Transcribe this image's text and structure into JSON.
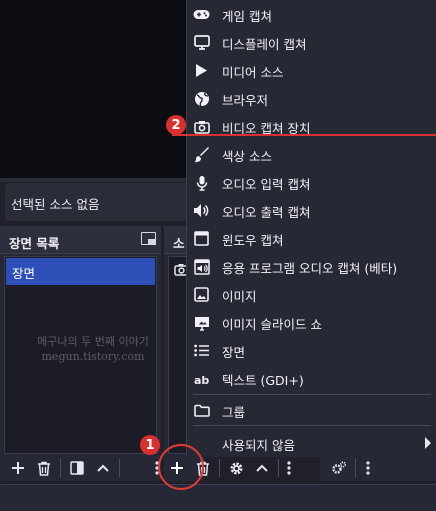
{
  "source_bar": {
    "text": "선택된 소스 없음"
  },
  "scenes": {
    "title": "장면 목록",
    "items": [
      "장면"
    ]
  },
  "sources": {
    "title": "소"
  },
  "watermark": {
    "line1": "메구나의 두 번째 이야기",
    "line2": "megun.tistory.com"
  },
  "menu": {
    "items": [
      {
        "label": "게임 캡쳐",
        "icon": "gamepad-icon"
      },
      {
        "label": "디스플레이 캡쳐",
        "icon": "monitor-icon"
      },
      {
        "label": "미디어 소스",
        "icon": "play-icon"
      },
      {
        "label": "브라우저",
        "icon": "globe-icon"
      },
      {
        "label": "비디오 캡쳐 장치",
        "icon": "camera-icon"
      },
      {
        "label": "색상 소스",
        "icon": "brush-icon"
      },
      {
        "label": "오디오 입력 캡쳐",
        "icon": "microphone-icon"
      },
      {
        "label": "오디오 출력 캡쳐",
        "icon": "speaker-icon"
      },
      {
        "label": "윈도우 캡쳐",
        "icon": "window-icon"
      },
      {
        "label": "응용 프로그램 오디오 캡쳐 (베타)",
        "icon": "app-audio-icon"
      },
      {
        "label": "이미지",
        "icon": "image-icon"
      },
      {
        "label": "이미지 슬라이드 쇼",
        "icon": "slideshow-icon"
      },
      {
        "label": "장면",
        "icon": "list-icon"
      },
      {
        "label": "텍스트 (GDI+)",
        "icon": "text-icon"
      }
    ],
    "group": {
      "label": "그룹",
      "icon": "folder-icon"
    },
    "deprecated": {
      "label": "사용되지 않음"
    }
  },
  "annotations": {
    "badge1": "1",
    "badge2": "2"
  },
  "colors": {
    "accent": "#2f4fb8",
    "annotation_red": "#d8302e",
    "background": "#1f2029"
  }
}
